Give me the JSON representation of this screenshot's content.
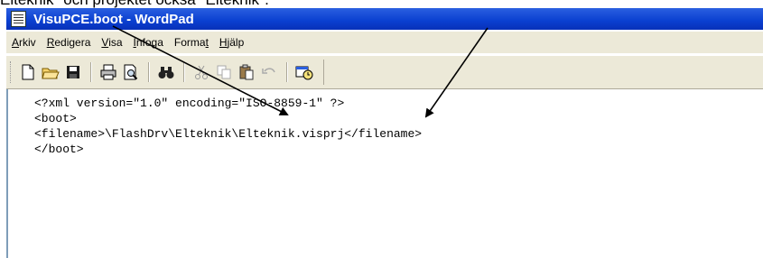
{
  "caption": "Elteknik\" och projektet också \"Elteknik\".",
  "window": {
    "title": "VisuPCE.boot - WordPad"
  },
  "menu": [
    {
      "key": "A",
      "rest": "rkiv"
    },
    {
      "key": "R",
      "rest": "edigera"
    },
    {
      "key": "V",
      "rest": "isa"
    },
    {
      "key": "I",
      "rest": "nfoga"
    },
    {
      "key": "Forma",
      "rest": "t"
    },
    {
      "key": "H",
      "rest": "jälp"
    }
  ],
  "toolbar": {
    "icons": [
      "new-document-icon",
      "open-folder-icon",
      "save-disk-icon",
      "print-icon",
      "print-preview-icon",
      "find-binoculars-icon",
      "cut-scissors-icon",
      "copy-icon",
      "paste-icon",
      "undo-icon",
      "insert-datetime-icon"
    ]
  },
  "document": {
    "lines": [
      "<?xml version=\"1.0\" encoding=\"ISO-8859-1\" ?>",
      "<boot>",
      "<filename>\\FlashDrv\\Elteknik\\Elteknik.visprj</filename>",
      "</boot>"
    ]
  },
  "colors": {
    "titlebar": "#0a3fd0",
    "chrome": "#ece9d8",
    "border": "#7f9db9"
  }
}
